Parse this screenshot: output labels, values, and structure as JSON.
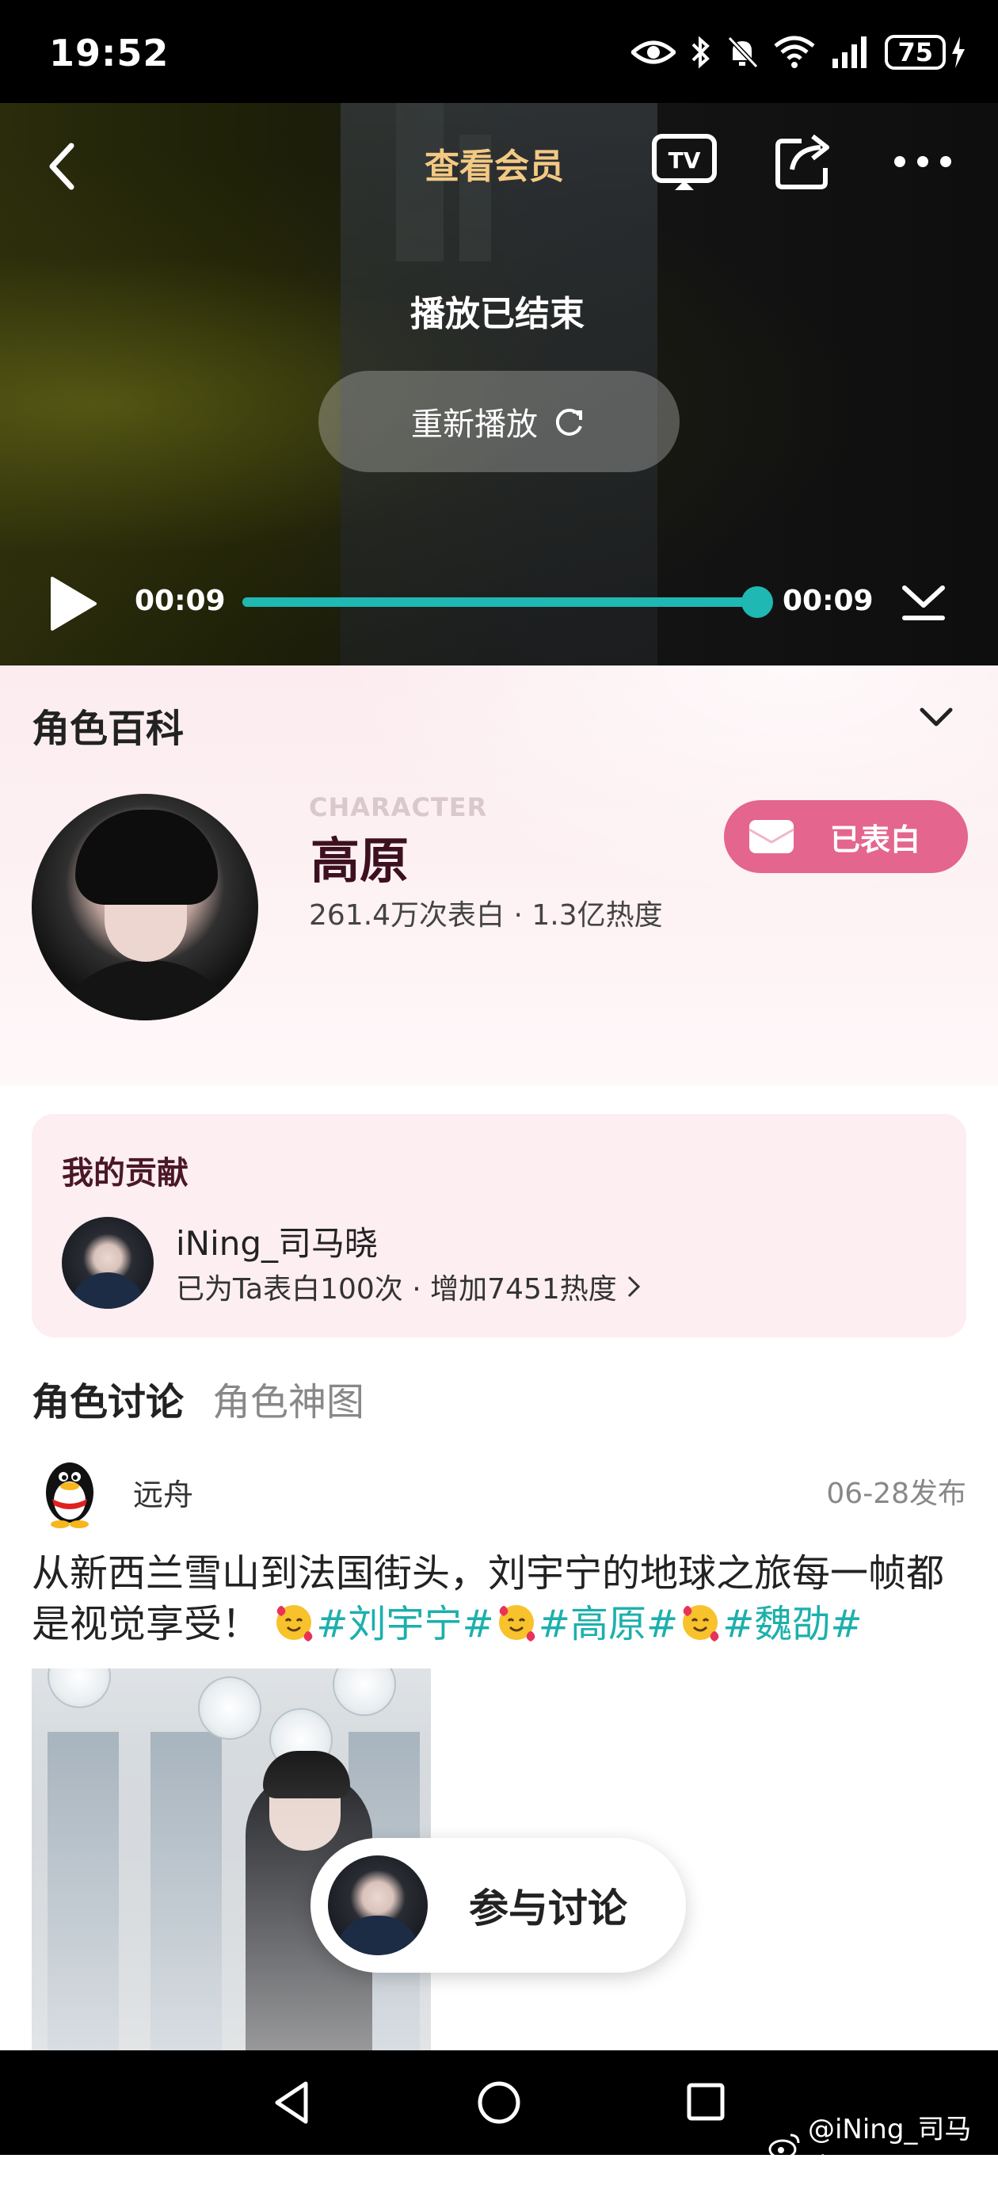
{
  "status_bar": {
    "time": "19:52",
    "battery": "75"
  },
  "player": {
    "member_link": "查看会员",
    "ended_text": "播放已结束",
    "replay_label": "重新播放",
    "current_time": "00:09",
    "total_time": "00:09",
    "progress": 1.0,
    "accent": "#1fb8b3"
  },
  "character": {
    "section_title": "角色百科",
    "en_label": "CHARACTER",
    "name": "高原",
    "stats": "261.4万次表白 · 1.3亿热度",
    "confess_label": "已表白",
    "confess_color": "#e4658e"
  },
  "contribution": {
    "title": "我的贡献",
    "user_name": "iNing_司马晓",
    "info": "已为Ta表白100次 · 增加7451热度"
  },
  "tabs": [
    {
      "label": "角色讨论",
      "active": true
    },
    {
      "label": "角色神图",
      "active": false
    }
  ],
  "post": {
    "user": "远舟",
    "date": "06-28发布",
    "text_plain": "从新西兰雪山到法国街头，刘宇宁的地球之旅每一帧都是视觉享受！",
    "tags": [
      "#刘宇宁#",
      "#高原#",
      "#魏劭#"
    ]
  },
  "join_label": "参与讨论",
  "watermark": "@iNing_司马晓"
}
